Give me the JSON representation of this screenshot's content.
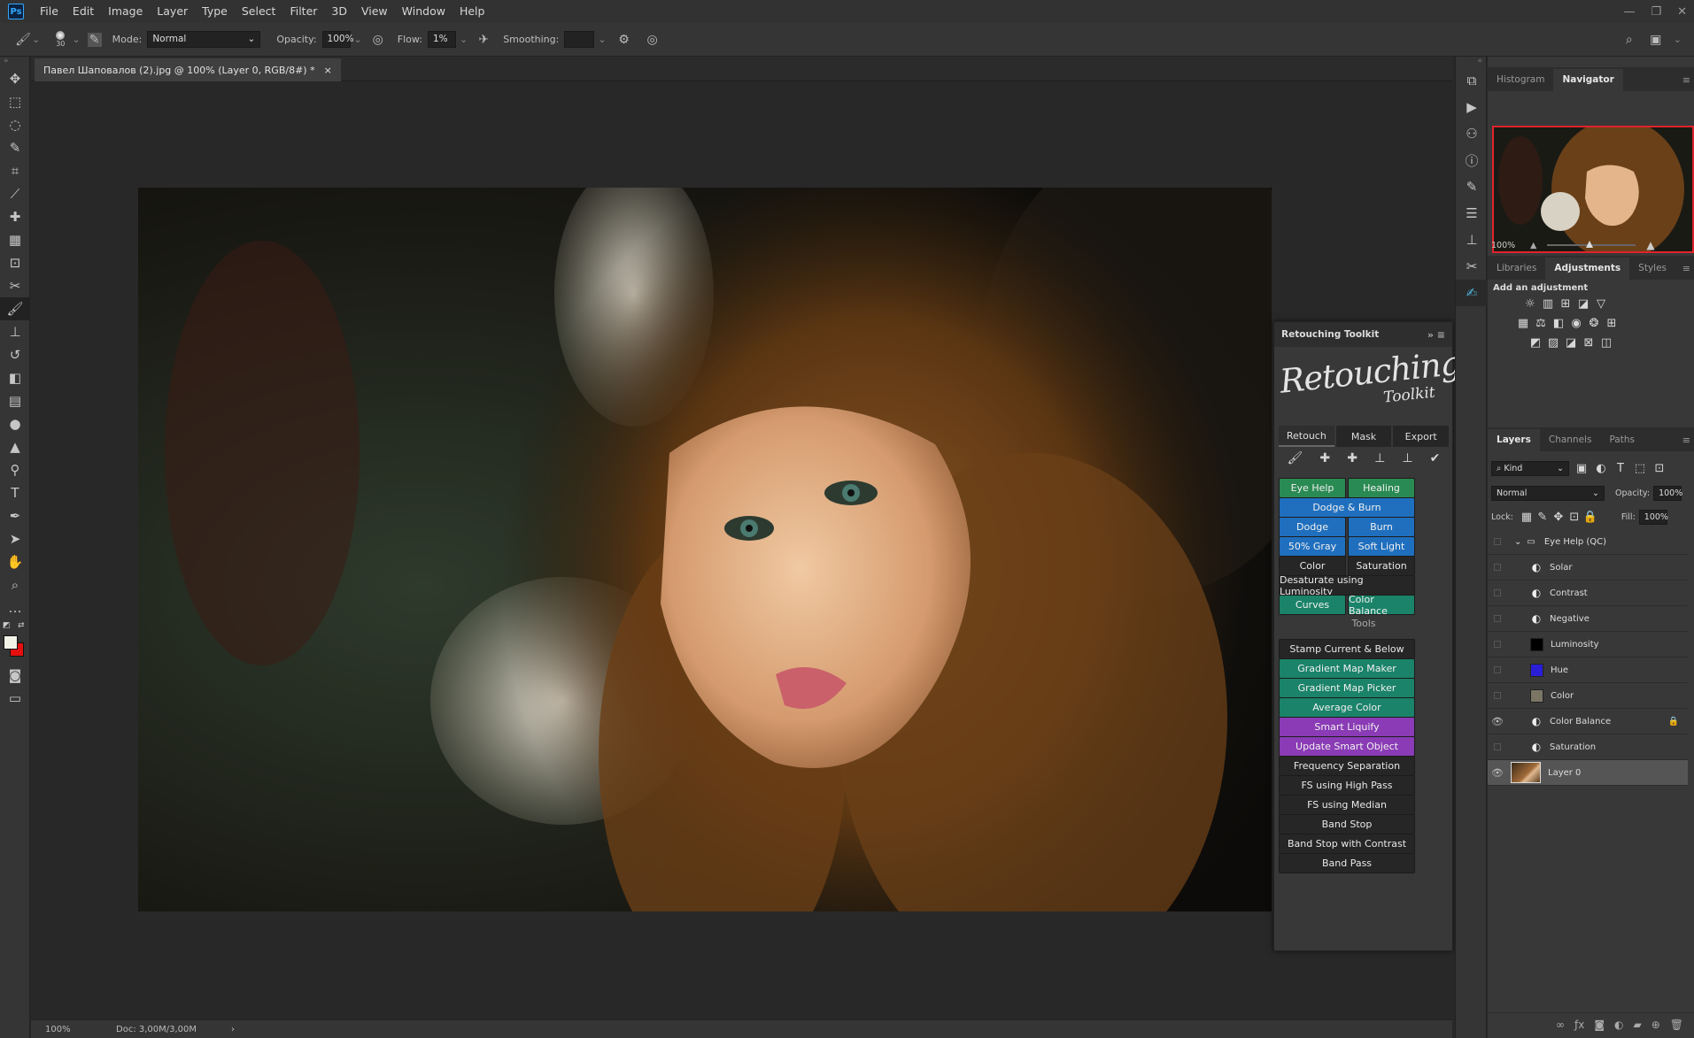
{
  "menu": {
    "logo": "Ps",
    "items": [
      "File",
      "Edit",
      "Image",
      "Layer",
      "Type",
      "Select",
      "Filter",
      "3D",
      "View",
      "Window",
      "Help"
    ]
  },
  "window_controls": [
    "—",
    "❐",
    "✕"
  ],
  "options": {
    "brush_size": "30",
    "mode_label": "Mode:",
    "mode_value": "Normal",
    "opacity_label": "Opacity:",
    "opacity_value": "100%",
    "flow_label": "Flow:",
    "flow_value": "1%",
    "smoothing_label": "Smoothing:",
    "smoothing_value": ""
  },
  "document": {
    "tab_title": "Павел Шаповалов  (2).jpg @ 100% (Layer 0, RGB/8#) *",
    "close": "×"
  },
  "status": {
    "zoom": "100%",
    "doc": "Doc: 3,00M/3,00M",
    "arrow": "›"
  },
  "panels": {
    "top_tabs": [
      "Histogram",
      "Navigator"
    ],
    "navigator_zoom": "100%",
    "adj_tabs": [
      "Libraries",
      "Adjustments",
      "Styles"
    ],
    "adj_title": "Add an adjustment",
    "layer_tabs": [
      "Layers",
      "Channels",
      "Paths"
    ],
    "kind_label": "Kind",
    "blend_mode": "Normal",
    "opacity_label": "Opacity:",
    "opacity_value": "100%",
    "lock_label": "Lock:",
    "fill_label": "Fill:",
    "fill_value": "100%"
  },
  "layers": [
    {
      "name": "Eye Help (QC)",
      "kind": "group",
      "visible": false
    },
    {
      "name": "Solar",
      "kind": "adjustment",
      "visible": false
    },
    {
      "name": "Contrast",
      "kind": "adjustment",
      "visible": false
    },
    {
      "name": "Negative",
      "kind": "adjustment",
      "visible": false
    },
    {
      "name": "Luminosity",
      "kind": "fill",
      "color": "#000000",
      "visible": false
    },
    {
      "name": "Hue",
      "kind": "fill",
      "color": "#2a1fd6",
      "visible": false
    },
    {
      "name": "Color",
      "kind": "fill",
      "color": "#7a7564",
      "visible": false
    },
    {
      "name": "Color Balance",
      "kind": "adjustment",
      "visible": true,
      "locked": true
    },
    {
      "name": "Saturation",
      "kind": "adjustment",
      "visible": false
    },
    {
      "name": "Layer 0",
      "kind": "image",
      "visible": true,
      "selected": true
    }
  ],
  "toolkit": {
    "title": "Retouching Toolkit",
    "logo_line1": "Retouching",
    "logo_line2": "Toolkit",
    "tabs": [
      "Retouch",
      "Mask",
      "Export"
    ],
    "buttons": {
      "eye_help": "Eye Help",
      "healing": "Healing",
      "dodge_burn": "Dodge & Burn",
      "dodge": "Dodge",
      "burn": "Burn",
      "gray50": "50% Gray",
      "soft_light": "Soft Light",
      "color": "Color",
      "saturation": "Saturation",
      "desaturate": "Desaturate using Luminosity",
      "curves": "Curves",
      "color_balance": "Color Balance"
    },
    "tools_label": "Tools",
    "tools": [
      {
        "label": "Stamp Current & Below",
        "style": "d"
      },
      {
        "label": "Gradient Map Maker",
        "style": "t"
      },
      {
        "label": "Gradient Map Picker",
        "style": "t"
      },
      {
        "label": "Average Color",
        "style": "t"
      },
      {
        "label": "Smart Liquify",
        "style": "p"
      },
      {
        "label": "Update Smart Object",
        "style": "p"
      },
      {
        "label": "Frequency Separation",
        "style": "d"
      },
      {
        "label": "FS using High Pass",
        "style": "d"
      },
      {
        "label": "FS using Median",
        "style": "d"
      },
      {
        "label": "Band Stop",
        "style": "d"
      },
      {
        "label": "Band Stop with Contrast",
        "style": "d"
      },
      {
        "label": "Band Pass",
        "style": "d"
      }
    ]
  },
  "colors": {
    "accent_blue": "#1f6fbe",
    "accent_green": "#2a8a53",
    "accent_teal": "#1a8369",
    "accent_purple": "#8a3bb5",
    "navigator_frame": "#e0232c"
  }
}
